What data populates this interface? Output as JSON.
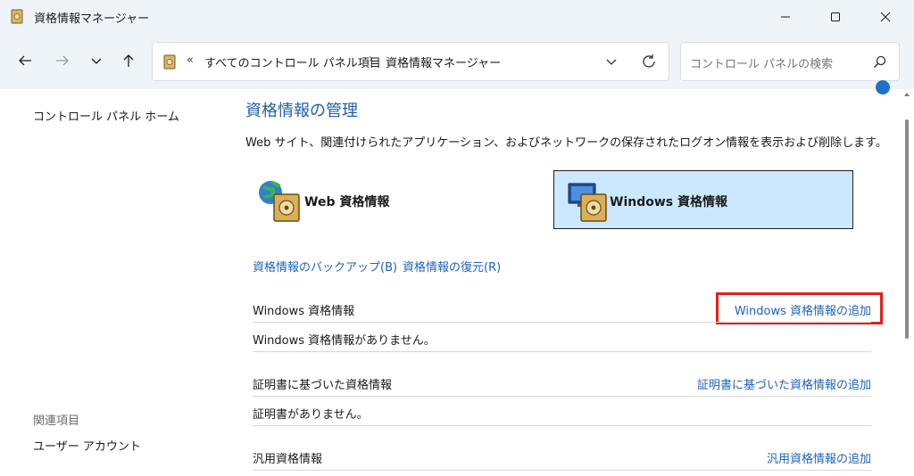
{
  "window": {
    "title": "資格情報マネージャー"
  },
  "address": {
    "chevron": "«",
    "crumbs": [
      "すべてのコントロール パネル項目",
      "資格情報マネージャー"
    ],
    "separator": "›"
  },
  "search": {
    "placeholder": "コントロール パネルの検索"
  },
  "sidebar": {
    "home": "コントロール パネル ホーム",
    "related_heading": "関連項目",
    "user_accounts": "ユーザー アカウント"
  },
  "main": {
    "heading": "資格情報の管理",
    "description": "Web サイト、関連付けられたアプリケーション、およびネットワークの保存されたログオン情報を表示および削除します。",
    "web_credentials": "Web 資格情報",
    "windows_credentials": "Windows 資格情報",
    "backup_link": "資格情報のバックアップ(B)",
    "restore_link": "資格情報の復元(R)",
    "sections": {
      "windows": {
        "title": "Windows 資格情報",
        "add": "Windows 資格情報の追加",
        "empty": "Windows 資格情報がありません。"
      },
      "certificate": {
        "title": "証明書に基づいた資格情報",
        "add": "証明書に基づいた資格情報の追加",
        "empty": "証明書がありません。"
      },
      "generic": {
        "title": "汎用資格情報",
        "add": "汎用資格情報の追加"
      }
    }
  },
  "colors": {
    "accent_link": "#1e63b6",
    "heading": "#1e5fa8",
    "selected_bg": "#cce8ff",
    "highlight_box": "#e0201b",
    "chrome_bg": "#eff4f9"
  },
  "icons": {
    "app": "credential-vault-icon",
    "back": "back-arrow-icon",
    "forward": "forward-arrow-icon",
    "recent": "chevron-down-icon",
    "up": "up-arrow-icon",
    "refresh": "refresh-icon",
    "search": "search-icon"
  }
}
